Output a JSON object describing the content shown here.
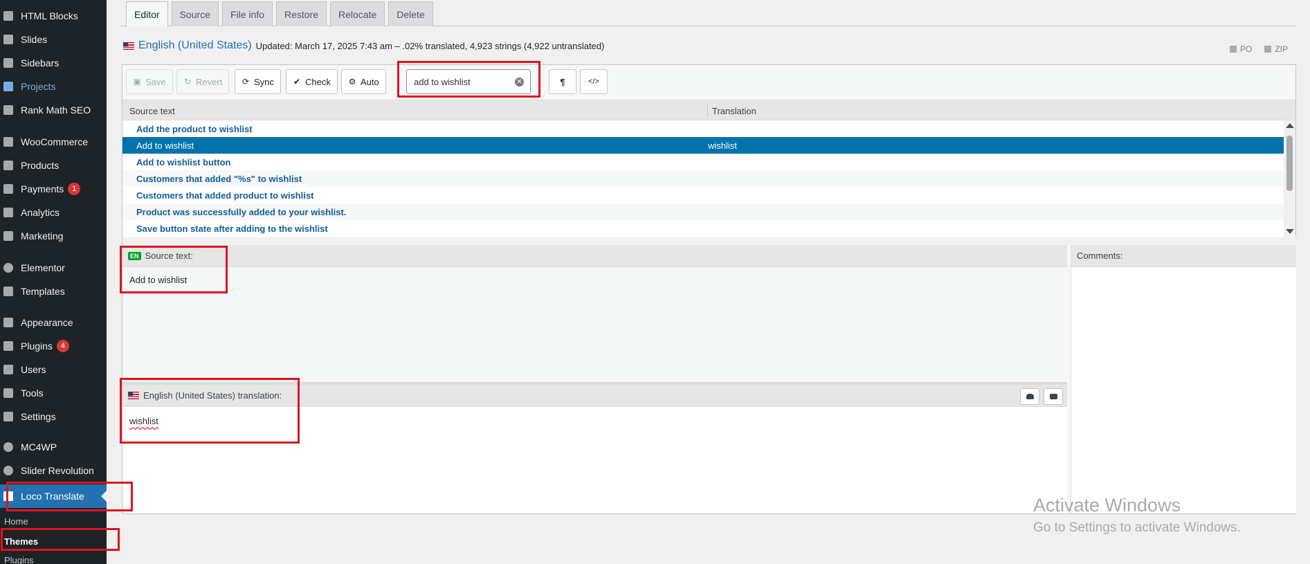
{
  "sidebar": {
    "items": [
      {
        "label": "HTML Blocks",
        "icon": "html-blocks-icon"
      },
      {
        "label": "Slides",
        "icon": "slides-icon"
      },
      {
        "label": "Sidebars",
        "icon": "sidebars-icon"
      },
      {
        "label": "Projects",
        "icon": "projects-icon"
      },
      {
        "label": "Rank Math SEO",
        "icon": "rank-math-icon"
      },
      {
        "label": "WooCommerce",
        "icon": "woocommerce-icon"
      },
      {
        "label": "Products",
        "icon": "products-icon"
      },
      {
        "label": "Payments",
        "icon": "payments-icon",
        "badge": "1"
      },
      {
        "label": "Analytics",
        "icon": "analytics-icon"
      },
      {
        "label": "Marketing",
        "icon": "marketing-icon"
      },
      {
        "label": "Elementor",
        "icon": "elementor-icon"
      },
      {
        "label": "Templates",
        "icon": "templates-icon"
      },
      {
        "label": "Appearance",
        "icon": "appearance-icon"
      },
      {
        "label": "Plugins",
        "icon": "plugins-icon",
        "badge": "4"
      },
      {
        "label": "Users",
        "icon": "users-icon"
      },
      {
        "label": "Tools",
        "icon": "tools-icon"
      },
      {
        "label": "Settings",
        "icon": "settings-icon"
      },
      {
        "label": "MC4WP",
        "icon": "mc4wp-icon"
      },
      {
        "label": "Slider Revolution",
        "icon": "slider-revolution-icon"
      }
    ],
    "current": {
      "label": "Loco Translate",
      "icon": "loco-translate-icon"
    },
    "submenu": [
      {
        "label": "Home"
      },
      {
        "label": "Themes"
      },
      {
        "label": "Plugins"
      }
    ]
  },
  "tabs": [
    {
      "label": "Editor"
    },
    {
      "label": "Source"
    },
    {
      "label": "File info"
    },
    {
      "label": "Restore"
    },
    {
      "label": "Relocate"
    },
    {
      "label": "Delete"
    }
  ],
  "locale": {
    "name": "English (United States)",
    "meta": "Updated: March 17, 2025 7:43 am – .02% translated, 4,923 strings (4,922 untranslated)"
  },
  "downloads": {
    "po": "PO",
    "zip": "ZIP"
  },
  "toolbar": {
    "save": "Save",
    "revert": "Revert",
    "sync": "Sync",
    "check": "Check",
    "auto": "Auto",
    "search_value": "add to wishlist",
    "pilcrow": "¶",
    "code": "</>"
  },
  "list": {
    "col_source": "Source text",
    "col_translation": "Translation",
    "rows": [
      {
        "source": "Add the product to wishlist",
        "translation": ""
      },
      {
        "source": "Add to wishlist",
        "translation": "wishlist"
      },
      {
        "source": "Add to wishlist button",
        "translation": ""
      },
      {
        "source": "Customers that added \"%s\" to wishlist",
        "translation": ""
      },
      {
        "source": "Customers that added product to wishlist",
        "translation": ""
      },
      {
        "source": "Product was successfully added to your wishlist.",
        "translation": ""
      },
      {
        "source": "Save button state after adding to the wishlist",
        "translation": ""
      }
    ]
  },
  "source_pane": {
    "lang": "EN",
    "label": "Source text:",
    "text": "Add to wishlist"
  },
  "translation_pane": {
    "label": "English (United States) translation:",
    "value": "wishlist"
  },
  "comments_pane": {
    "label": "Comments:"
  },
  "watermark": {
    "title": "Activate Windows",
    "subtitle": "Go to Settings to activate Windows."
  },
  "colors": {
    "accent": "#2271b1",
    "selected_row": "#0073aa",
    "highlight": "#e0141e",
    "badge": "#d63638"
  }
}
